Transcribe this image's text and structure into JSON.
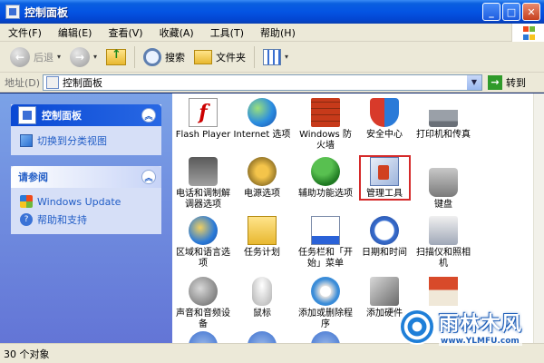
{
  "window": {
    "title": "控制面板"
  },
  "menu": [
    "文件(F)",
    "编辑(E)",
    "查看(V)",
    "收藏(A)",
    "工具(T)",
    "帮助(H)"
  ],
  "toolbar": {
    "back": "后退",
    "search": "搜索",
    "folders": "文件夹"
  },
  "address": {
    "label": "地址(D)",
    "value": "控制面板",
    "go": "转到"
  },
  "sidebar": {
    "panel1": {
      "title": "控制面板",
      "link": "切换到分类视图"
    },
    "panel2": {
      "title": "请参阅",
      "links": [
        "Windows Update",
        "帮助和支持"
      ]
    }
  },
  "items": [
    "Flash Player",
    "Internet 选项",
    "Windows 防火墙",
    "安全中心",
    "打印机和传真",
    "电话和调制解调器选项",
    "电源选项",
    "辅助功能选项",
    "管理工具",
    "键盘",
    "区域和语言选项",
    "任务计划",
    "任务栏和「开始」菜单",
    "日期和时间",
    "扫描仪和照相机",
    "声音和音频设备",
    "鼠标",
    "添加或删除程序",
    "添加硬件",
    ""
  ],
  "status": "30 个对象",
  "watermark": {
    "name": "雨林木风",
    "url": "www.YLMFU.com"
  },
  "colors": {
    "highlight": "#d52a2a",
    "title_blue": "#0454e3",
    "link_blue": "#215dc6"
  }
}
